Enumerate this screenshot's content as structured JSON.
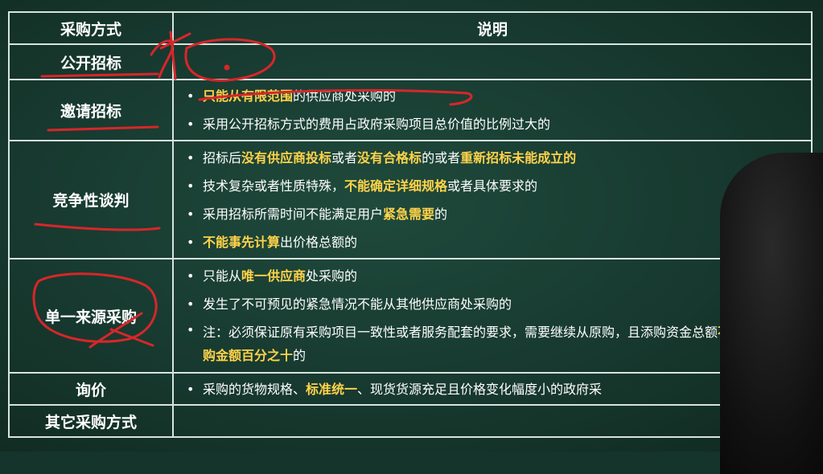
{
  "table": {
    "header": {
      "method": "采购方式",
      "description": "说明"
    },
    "rows": [
      {
        "method": "公开招标",
        "bullets": []
      },
      {
        "method": "邀请招标",
        "bullets": [
          [
            {
              "t": "只能从有限范围",
              "hl": true
            },
            {
              "t": "的供应商处采购的",
              "hl": false
            }
          ],
          [
            {
              "t": "采用公开招标方式的费用占政府采购项目总价值的比例过大的",
              "hl": false
            }
          ]
        ]
      },
      {
        "method": "竞争性谈判",
        "bullets": [
          [
            {
              "t": "招标后",
              "hl": false
            },
            {
              "t": "没有供应商投标",
              "hl": true
            },
            {
              "t": "或者",
              "hl": false
            },
            {
              "t": "没有合格标",
              "hl": true
            },
            {
              "t": "的或者",
              "hl": false
            },
            {
              "t": "重新招标未能成立的",
              "hl": true
            }
          ],
          [
            {
              "t": "技术复杂或者性质特殊，",
              "hl": false
            },
            {
              "t": "不能确定详细规格",
              "hl": true
            },
            {
              "t": "或者具体要求的",
              "hl": false
            }
          ],
          [
            {
              "t": "采用招标所需时间不能满足用户",
              "hl": false
            },
            {
              "t": "紧急需要",
              "hl": true
            },
            {
              "t": "的",
              "hl": false
            }
          ],
          [
            {
              "t": "不能事先计算",
              "hl": true
            },
            {
              "t": "出价格总额的",
              "hl": false
            }
          ]
        ]
      },
      {
        "method": "单一来源采购",
        "bullets": [
          [
            {
              "t": "只能从",
              "hl": false
            },
            {
              "t": "唯一供应商",
              "hl": true
            },
            {
              "t": "处采购的",
              "hl": false
            }
          ],
          [
            {
              "t": "发生了不可预见的紧急情况不能从其他供应商处采购的",
              "hl": false
            }
          ],
          [
            {
              "t": "注：必须保证原有采购项目一致性或者服务配套的要求，需要继续从原",
              "hl": false
            },
            {
              "t": "购，且添购资金总额",
              "hl": false
            },
            {
              "t": "不超过原合同采购金额百分之十",
              "hl": true
            },
            {
              "t": "的",
              "hl": false
            }
          ]
        ]
      },
      {
        "method": "询价",
        "bullets": [
          [
            {
              "t": "采购的货物规格、",
              "hl": false
            },
            {
              "t": "标准统一",
              "hl": true
            },
            {
              "t": "、现货货源充足且价格变化幅度小的政府采",
              "hl": false
            }
          ]
        ]
      },
      {
        "method": "其它采购方式",
        "bullets": []
      }
    ]
  },
  "colors": {
    "board": "#17392f",
    "highlight": "#ffd34a",
    "annotation": "#d8262a",
    "border": "#d9e3df"
  }
}
